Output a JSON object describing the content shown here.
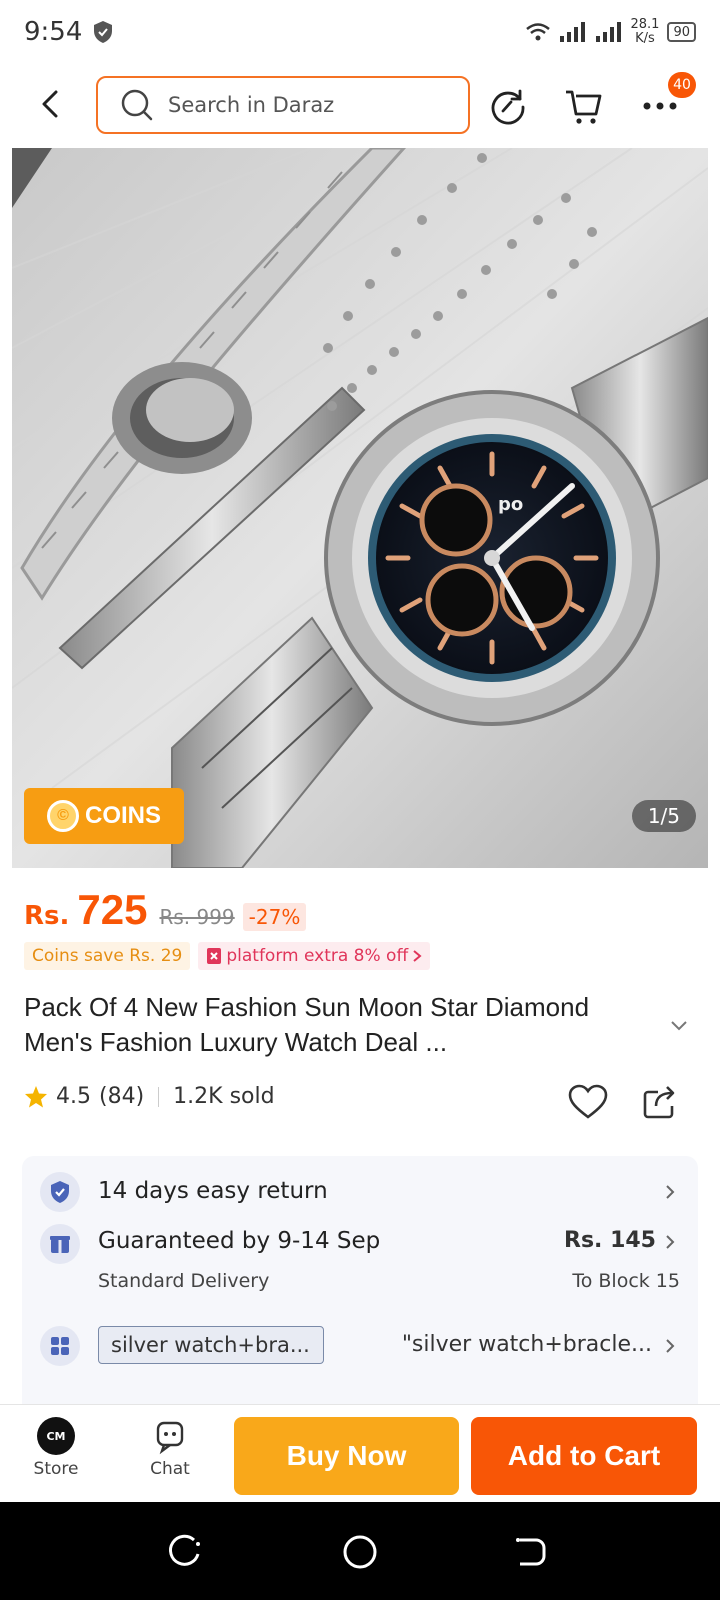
{
  "status": {
    "time": "9:54",
    "net_speed_value": "28.1",
    "net_speed_unit": "K/s",
    "battery": "90"
  },
  "nav": {
    "search_placeholder": "Search in Daraz",
    "more_badge": "40"
  },
  "gallery": {
    "coins_label": "COINS",
    "counter": "1/5"
  },
  "price": {
    "currency": "Rs.",
    "current": "725",
    "original": "Rs. 999",
    "discount": "-27%"
  },
  "promos": {
    "coins_save": "Coins save Rs. 29",
    "platform": "platform extra 8% off"
  },
  "product": {
    "title": "Pack Of 4 New Fashion Sun Moon Star Diamond  Men's Fashion Luxury  Watch Deal  ...",
    "rating": "4.5",
    "rating_count": "(84)",
    "sold": "1.2K sold"
  },
  "info": {
    "return": "14 days easy return",
    "delivery": "Guaranteed by 9-14 Sep",
    "delivery_type": "Standard Delivery",
    "delivery_fee": "Rs. 145",
    "delivery_to": "To Block 15",
    "variant_chip": "silver watch+bra...",
    "variant_text": "\"silver watch+bracle..."
  },
  "bottom": {
    "store_label": "Store",
    "chat_label": "Chat",
    "buy_now": "Buy Now",
    "add_to_cart": "Add to Cart"
  },
  "colors": {
    "brand_orange": "#f85606",
    "buy_now": "#f9a81a",
    "coins": "#f79d12"
  }
}
